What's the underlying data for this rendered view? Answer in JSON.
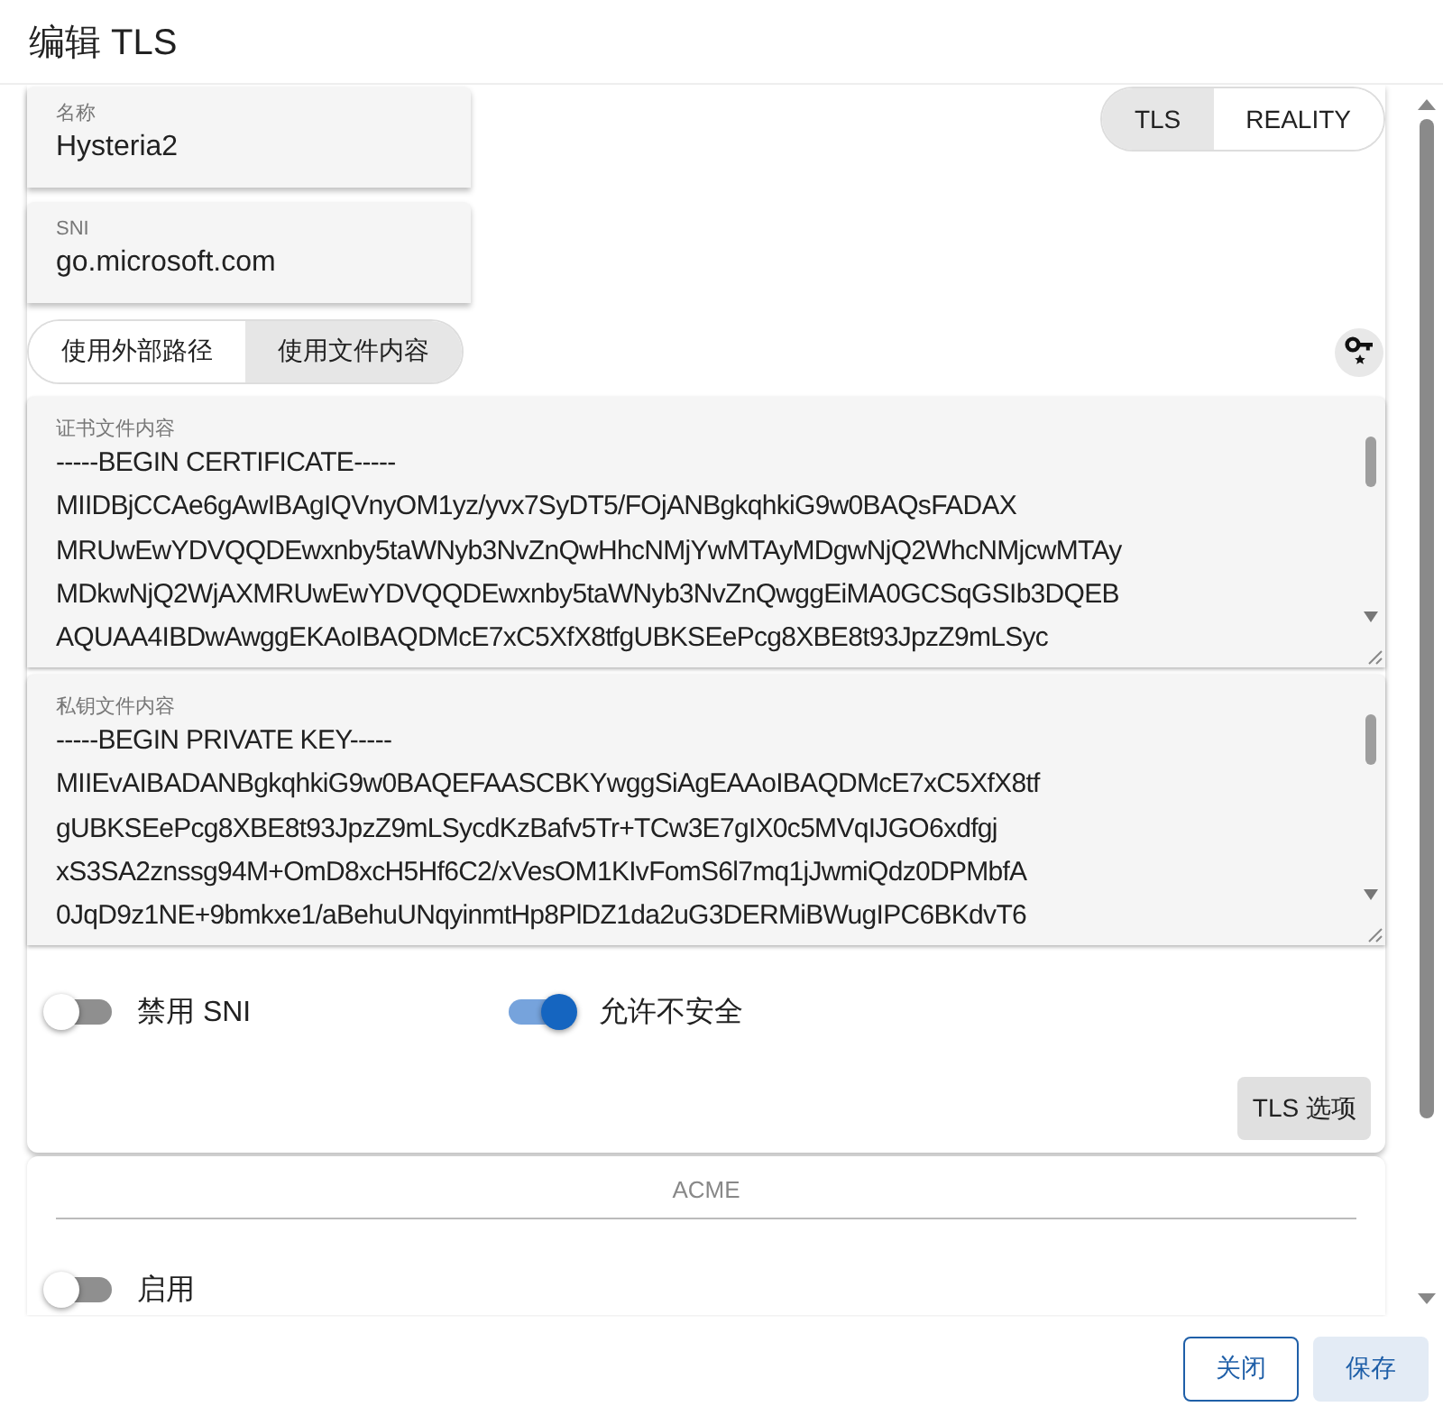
{
  "dialog": {
    "title": "编辑 TLS"
  },
  "security_tabs": [
    {
      "label": "TLS",
      "selected": true
    },
    {
      "label": "REALITY",
      "selected": false
    }
  ],
  "fields": [
    {
      "label": "名称",
      "value": "Hysteria2"
    },
    {
      "label": "SNI",
      "value": "go.microsoft.com"
    }
  ],
  "source_tabs": [
    {
      "label": "使用外部路径",
      "selected": false
    },
    {
      "label": "使用文件内容",
      "selected": true
    }
  ],
  "text_areas": [
    {
      "label": "证书文件内容",
      "value": "-----BEGIN CERTIFICATE-----\nMIIDBjCCAe6gAwIBAgIQVnyOM1yz/yvx7SyDT5/FOjANBgkqhkiG9w0BAQsFADAX\nMRUwEwYDVQQDEwxnby5taWNyb3NvZnQwHhcNMjYwMTAyMDgwNjQ2WhcNMjcwMTAy\nMDkwNjQ2WjAXMRUwEwYDVQQDEwxnby5taWNyb3NvZnQwggEiMA0GCSqGSIb3DQEB\nAQUAA4IBDwAwggEKAoIBAQDMcE7xC5XfX8tfgUBKSEePcg8XBE8t93JpzZ9mLSyc"
    },
    {
      "label": "私钥文件内容",
      "value": "-----BEGIN PRIVATE KEY-----\nMIIEvAIBADANBgkqhkiG9w0BAQEFAASCBKYwggSiAgEAAoIBAQDMcE7xC5XfX8tf\ngUBKSEePcg8XBE8t93JpzZ9mLSycdKzBafv5Tr+TCw3E7gIX0c5MVqIJGO6xdfgj\nxS3SA2znssg94M+OmD8xcH5Hf6C2/xVesOM1KIvFomS6l7mq1jJwmiQdz0DPMbfA\n0JqD9z1NE+9bmkxe1/aBehuUNqyinmtHp8PlDZ1da2uG3DERMiBWugIPC6BKdvT6"
    }
  ],
  "switches": [
    {
      "label": "禁用 SNI",
      "on": false
    },
    {
      "label": "允许不安全",
      "on": true
    }
  ],
  "options_button": "TLS 选项",
  "acme": {
    "heading": "ACME",
    "switches": [
      {
        "label": "启用",
        "on": false
      }
    ]
  },
  "buttons": [
    {
      "label": "关闭",
      "kind": "outlined"
    },
    {
      "label": "保存",
      "kind": "tonal"
    }
  ]
}
